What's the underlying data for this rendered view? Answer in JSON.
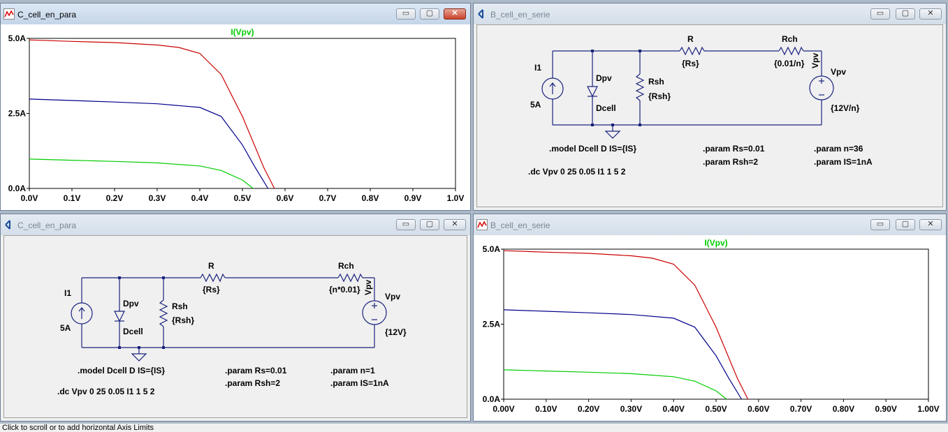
{
  "windows": {
    "plot_para": {
      "title": "C_cell_en_para"
    },
    "sch_serie": {
      "title": "B_cell_en_serie"
    },
    "sch_para": {
      "title": "C_cell_en_para"
    },
    "plot_serie": {
      "title": "B_cell_en_serie"
    }
  },
  "controls": {
    "minimize": "▭",
    "maximize": "▢",
    "close": "✕"
  },
  "status_text": "Click to scroll or to add horizontal Axis Limits",
  "schematic_serie": {
    "I1": "I1",
    "I1_value": "5A",
    "Dpv": "Dpv",
    "Dpv_model": "Dcell",
    "Rsh": "Rsh",
    "Rsh_value": "{Rsh}",
    "R": "R",
    "R_value": "{Rs}",
    "Rch": "Rch",
    "Rch_value": "{0.01/n}",
    "net": "Vpv",
    "Vpv": "Vpv",
    "Vpv_value": "{12V/n}",
    "model": ".model Dcell D IS={IS}",
    "dc": ".dc Vpv 0 25 0.05 I1 1 5 2",
    "param_rs": ".param Rs=0.01",
    "param_rsh": ".param Rsh=2",
    "param_n": ".param n=36",
    "param_is": ".param IS=1nA"
  },
  "schematic_para": {
    "I1": "I1",
    "I1_value": "5A",
    "Dpv": "Dpv",
    "Dpv_model": "Dcell",
    "Rsh": "Rsh",
    "Rsh_value": "{Rsh}",
    "R": "R",
    "R_value": "{Rs}",
    "Rch": "Rch",
    "Rch_value": "{n*0.01}",
    "net": "Vpv",
    "Vpv": "Vpv",
    "Vpv_value": "{12V}",
    "model": ".model Dcell D IS={IS}",
    "dc": ".dc Vpv 0 25 0.05 I1 1 5 2",
    "param_rs": ".param Rs=0.01",
    "param_rsh": ".param Rsh=2",
    "param_n": ".param n=1",
    "param_is": ".param IS=1nA"
  },
  "colors": {
    "trace_5A": "#cc0000",
    "trace_3A": "#00008b",
    "trace_1A": "#00cc00",
    "trace_title": "#00cc00"
  },
  "chart_data": [
    {
      "type": "line",
      "title": "I(Vpv)",
      "xlim": [
        0,
        1.0
      ],
      "ylim": [
        0,
        5.0
      ],
      "xticks": [
        "0.0V",
        "0.1V",
        "0.2V",
        "0.3V",
        "0.4V",
        "0.5V",
        "0.6V",
        "0.7V",
        "0.8V",
        "0.9V",
        "1.0V"
      ],
      "yticks": [
        "0.0A",
        "2.5A",
        "5.0A"
      ],
      "series": [
        {
          "color": "#cc0000",
          "x": [
            0,
            0.1,
            0.2,
            0.3,
            0.35,
            0.4,
            0.45,
            0.5,
            0.55,
            0.575
          ],
          "y": [
            4.95,
            4.9,
            4.86,
            4.78,
            4.7,
            4.5,
            3.8,
            2.4,
            0.7,
            0
          ]
        },
        {
          "color": "#00008b",
          "x": [
            0,
            0.1,
            0.2,
            0.3,
            0.4,
            0.45,
            0.5,
            0.53,
            0.56
          ],
          "y": [
            2.98,
            2.93,
            2.88,
            2.82,
            2.7,
            2.4,
            1.45,
            0.7,
            0
          ]
        },
        {
          "color": "#00cc00",
          "x": [
            0,
            0.1,
            0.2,
            0.3,
            0.4,
            0.45,
            0.5,
            0.525
          ],
          "y": [
            0.98,
            0.94,
            0.9,
            0.85,
            0.75,
            0.6,
            0.28,
            0
          ]
        }
      ]
    },
    {
      "type": "line",
      "title": "I(Vpv)",
      "xlim": [
        0,
        1.0
      ],
      "ylim": [
        0,
        5.0
      ],
      "xticks": [
        "0.00V",
        "0.10V",
        "0.20V",
        "0.30V",
        "0.40V",
        "0.50V",
        "0.60V",
        "0.70V",
        "0.80V",
        "0.90V",
        "1.00V"
      ],
      "yticks": [
        "0.0A",
        "2.5A",
        "5.0A"
      ],
      "series": [
        {
          "color": "#cc0000",
          "x": [
            0,
            0.1,
            0.2,
            0.3,
            0.35,
            0.4,
            0.45,
            0.5,
            0.55,
            0.575
          ],
          "y": [
            4.95,
            4.9,
            4.86,
            4.78,
            4.7,
            4.5,
            3.8,
            2.4,
            0.7,
            0
          ]
        },
        {
          "color": "#00008b",
          "x": [
            0,
            0.1,
            0.2,
            0.3,
            0.4,
            0.45,
            0.5,
            0.53,
            0.56
          ],
          "y": [
            2.98,
            2.93,
            2.88,
            2.82,
            2.7,
            2.4,
            1.45,
            0.7,
            0
          ]
        },
        {
          "color": "#00cc00",
          "x": [
            0,
            0.1,
            0.2,
            0.3,
            0.4,
            0.45,
            0.5,
            0.525
          ],
          "y": [
            0.98,
            0.94,
            0.9,
            0.85,
            0.75,
            0.6,
            0.28,
            0
          ]
        }
      ]
    }
  ]
}
